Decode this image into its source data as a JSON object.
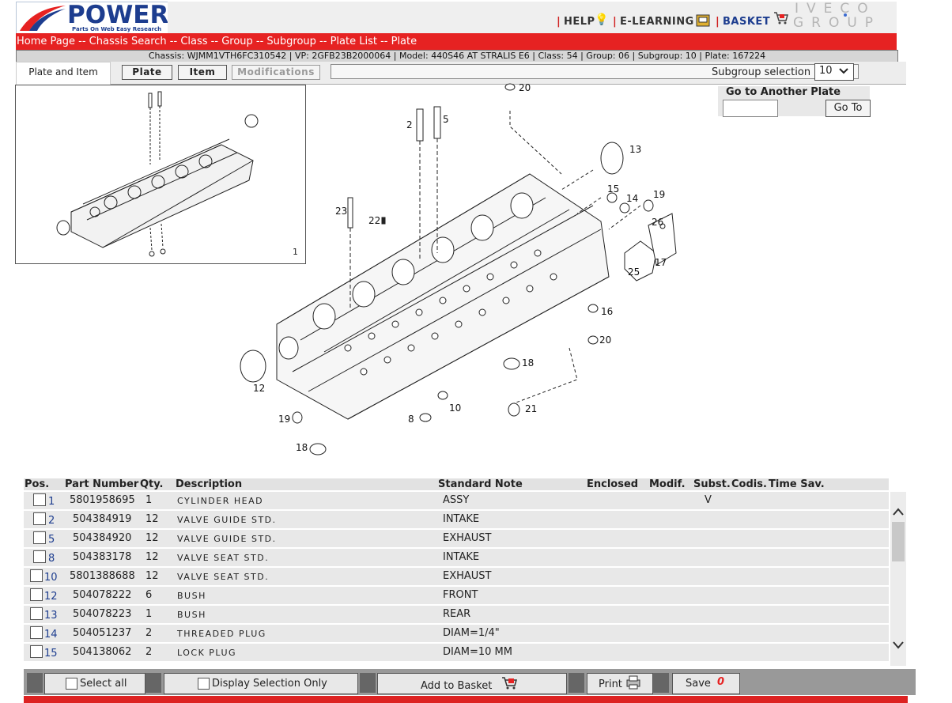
{
  "brand": {
    "logo_text": "POWER",
    "logo_sub": "Parts On Web Easy Research",
    "partner_logo_line1": "IVECO",
    "partner_logo_line2": "GROUP"
  },
  "header": {
    "help": "HELP",
    "elearning": "E-LEARNING",
    "basket": "BASKET",
    "sep": "|"
  },
  "breadcrumb": {
    "items": [
      "Home Page",
      "Chassis Search",
      "Class",
      "Group",
      "Subgroup",
      "Plate List",
      "Plate"
    ],
    "separator": " -- "
  },
  "infobar": "Chassis: WJMM1VTH6FC310542 | VP: 2GFB23B2000064 | Model: 440S46 AT STRALIS E6 | Class: 54 | Group: 06 | Subgroup: 10 | Plate: 167224",
  "tabs": {
    "plate_and_item": "Plate and Item",
    "plate": "Plate",
    "item": "Item",
    "modifications": "Modifications"
  },
  "subgroup": {
    "label": "Subgroup selection",
    "value": "10"
  },
  "goto": {
    "title": "Go to Another Plate",
    "input_value": "",
    "button": "Go To"
  },
  "thumbnail": {
    "plate_number": "1"
  },
  "diagram_labels": [
    "20",
    "2",
    "5",
    "13",
    "15",
    "14",
    "19",
    "26",
    "17",
    "25",
    "16",
    "20",
    "18",
    "21",
    "10",
    "8",
    "19",
    "18",
    "12",
    "23",
    "22"
  ],
  "table": {
    "headers": [
      "Pos.",
      "Part Number",
      "Qty.",
      "Description",
      "Standard Note",
      "Enclosed",
      "Modif.",
      "Subst.",
      "Codis.",
      "Time Sav."
    ],
    "rows": [
      {
        "pos": "1",
        "part": "5801958695",
        "qty": "1",
        "desc": "CYLINDER HEAD",
        "note": "ASSY",
        "subst": "V"
      },
      {
        "pos": "2",
        "part": "504384919",
        "qty": "12",
        "desc": "VALVE GUIDE STD.",
        "note": "INTAKE",
        "subst": ""
      },
      {
        "pos": "5",
        "part": "504384920",
        "qty": "12",
        "desc": "VALVE GUIDE STD.",
        "note": "EXHAUST",
        "subst": ""
      },
      {
        "pos": "8",
        "part": "504383178",
        "qty": "12",
        "desc": "VALVE SEAT STD.",
        "note": "INTAKE",
        "subst": ""
      },
      {
        "pos": "10",
        "part": "5801388688",
        "qty": "12",
        "desc": "VALVE SEAT STD.",
        "note": "EXHAUST",
        "subst": ""
      },
      {
        "pos": "12",
        "part": "504078222",
        "qty": "6",
        "desc": "BUSH",
        "note": "FRONT",
        "subst": ""
      },
      {
        "pos": "13",
        "part": "504078223",
        "qty": "1",
        "desc": "BUSH",
        "note": "REAR",
        "subst": ""
      },
      {
        "pos": "14",
        "part": "504051237",
        "qty": "2",
        "desc": "THREADED PLUG",
        "note": "DIAM=1/4\"",
        "subst": ""
      },
      {
        "pos": "15",
        "part": "504138062",
        "qty": "2",
        "desc": "LOCK PLUG",
        "note": "DIAM=10 MM",
        "subst": ""
      }
    ]
  },
  "footer": {
    "select_all": "Select all",
    "display_selection": "Display Selection Only",
    "add_to_basket": "Add to Basket",
    "print": "Print",
    "save": "Save",
    "save_count": "0"
  },
  "colors": {
    "brand_blue": "#1d3d8f",
    "breadcrumb_red": "#e62222"
  }
}
